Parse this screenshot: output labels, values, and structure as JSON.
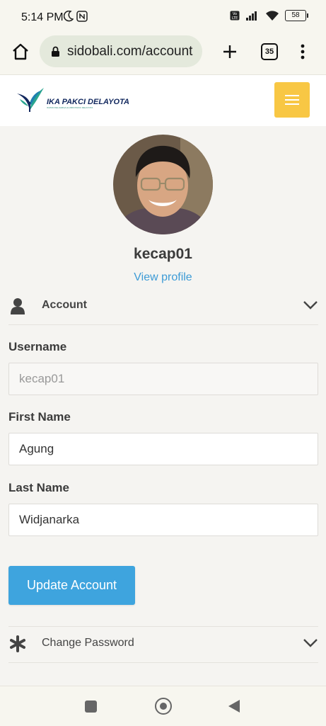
{
  "status_bar": {
    "time": "5:14 PM",
    "battery": "58",
    "icons": [
      "moon-icon",
      "nfc-icon",
      "volte-icon",
      "signal-icon",
      "wifi-icon",
      "battery-icon"
    ]
  },
  "browser": {
    "url": "sidobali.com/account",
    "tab_count": "35",
    "icons": [
      "home-icon",
      "lock-icon",
      "plus-icon",
      "more-vert-icon"
    ]
  },
  "site": {
    "logo_text": "IKA PAKCI DELAYOTA",
    "logo_subtext": "IKATAN KELUARGA ALUMNI PAKCI DELAYOTA"
  },
  "profile": {
    "username": "kecap01",
    "view_profile": "View profile"
  },
  "account_section": {
    "title": "Account",
    "expanded": true
  },
  "form": {
    "username_label": "Username",
    "username_value": "kecap01",
    "first_name_label": "First Name",
    "first_name_value": "Agung",
    "last_name_label": "Last Name",
    "last_name_value": "Widjanarka",
    "submit_label": "Update Account"
  },
  "password_section": {
    "title": "Change Password",
    "expanded": false
  },
  "colors": {
    "accent_blue": "#3ea4de",
    "hamburger_yellow": "#f8c744",
    "background": "#f5f4f1"
  }
}
